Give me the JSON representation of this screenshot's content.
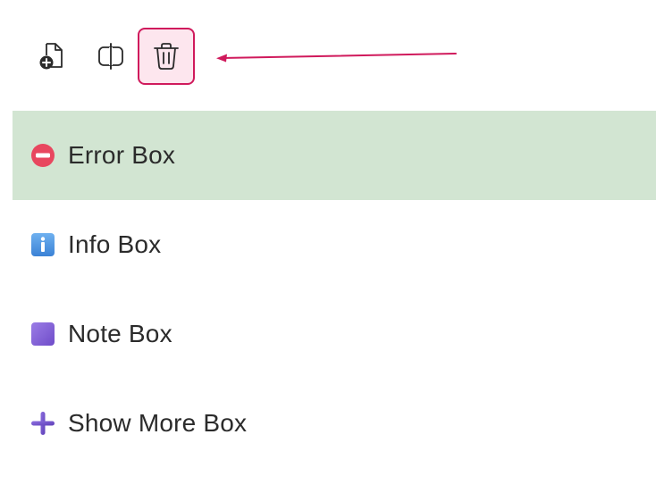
{
  "toolbar": {
    "buttons": [
      {
        "name": "add-document-button",
        "icon": "add-document-icon"
      },
      {
        "name": "split-view-button",
        "icon": "split-panel-icon"
      },
      {
        "name": "delete-button",
        "icon": "trash-icon",
        "highlighted": true
      }
    ]
  },
  "annotation": {
    "arrow_color": "#d01a5c",
    "points_to": "delete-button"
  },
  "colors": {
    "selected_row": "#d2e5d2",
    "highlight_border": "#d01a5c",
    "highlight_fill": "#fde6ee"
  },
  "boxes": [
    {
      "label": "Error Box",
      "icon": "no-entry-icon",
      "selected": true
    },
    {
      "label": "Info Box",
      "icon": "info-icon",
      "selected": false
    },
    {
      "label": "Note Box",
      "icon": "purple-square-icon",
      "selected": false
    },
    {
      "label": "Show More Box",
      "icon": "plus-icon",
      "selected": false
    }
  ]
}
